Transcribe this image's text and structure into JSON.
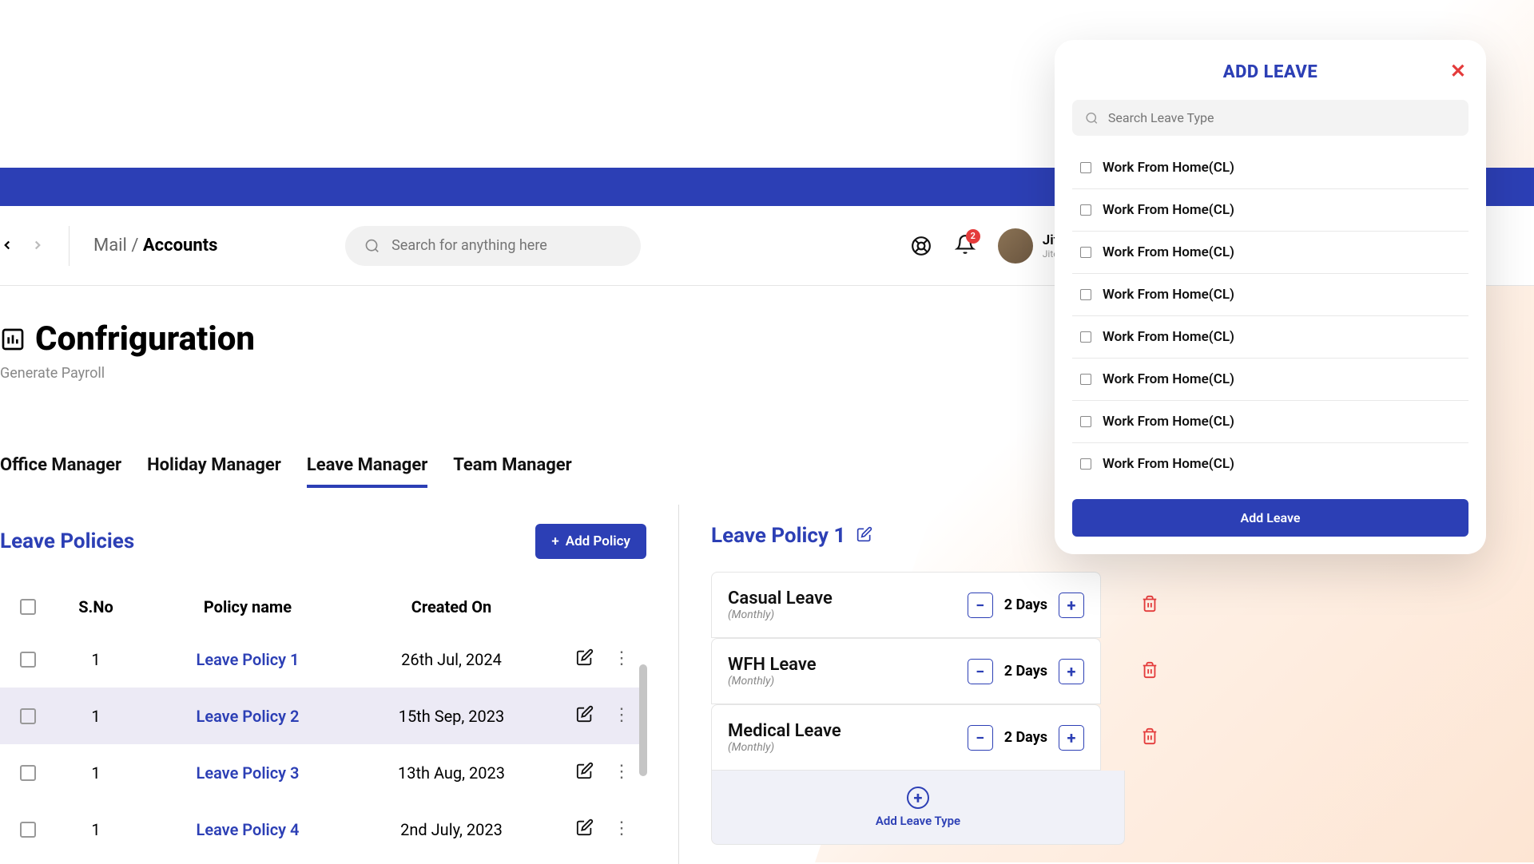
{
  "breadcrumb": {
    "parent": "Mail",
    "current": "Accounts"
  },
  "search": {
    "placeholder": "Search for anything here"
  },
  "notifications": {
    "count": "2"
  },
  "user": {
    "name": "Jitendra Sing",
    "email": "Jitendra@gofloww.co"
  },
  "page": {
    "title": "Confriguration",
    "subtitle": "Generate Payroll"
  },
  "tabs": [
    {
      "label": "Office Manager"
    },
    {
      "label": "Holiday Manager"
    },
    {
      "label": "Leave Manager"
    },
    {
      "label": "Team Manager"
    }
  ],
  "leftPanel": {
    "title": "Leave Policies",
    "addBtn": "Add Policy",
    "headers": {
      "sno": "S.No",
      "name": "Policy name",
      "date": "Created On"
    },
    "rows": [
      {
        "sno": "1",
        "name": "Leave Policy 1",
        "date": "26th Jul, 2024"
      },
      {
        "sno": "1",
        "name": "Leave Policy 2",
        "date": "15th Sep, 2023"
      },
      {
        "sno": "1",
        "name": "Leave Policy 3",
        "date": "13th Aug, 2023"
      },
      {
        "sno": "1",
        "name": "Leave Policy 4",
        "date": "2nd July, 2023"
      }
    ]
  },
  "rightPanel": {
    "title": "Leave Policy 1",
    "items": [
      {
        "name": "Casual Leave",
        "sub": "(Monthly)",
        "days": "2 Days"
      },
      {
        "name": "WFH Leave",
        "sub": "(Monthly)",
        "days": "2 Days"
      },
      {
        "name": "Medical Leave",
        "sub": "(Monthly)",
        "days": "2 Days"
      }
    ],
    "addLeaveType": "Add Leave Type"
  },
  "modal": {
    "title": "ADD LEAVE",
    "searchPlaceholder": "Search Leave Type",
    "items": [
      "Work From Home(CL)",
      "Work From Home(CL)",
      "Work From Home(CL)",
      "Work From Home(CL)",
      "Work From Home(CL)",
      "Work From Home(CL)",
      "Work From Home(CL)",
      "Work From Home(CL)"
    ],
    "button": "Add Leave"
  }
}
